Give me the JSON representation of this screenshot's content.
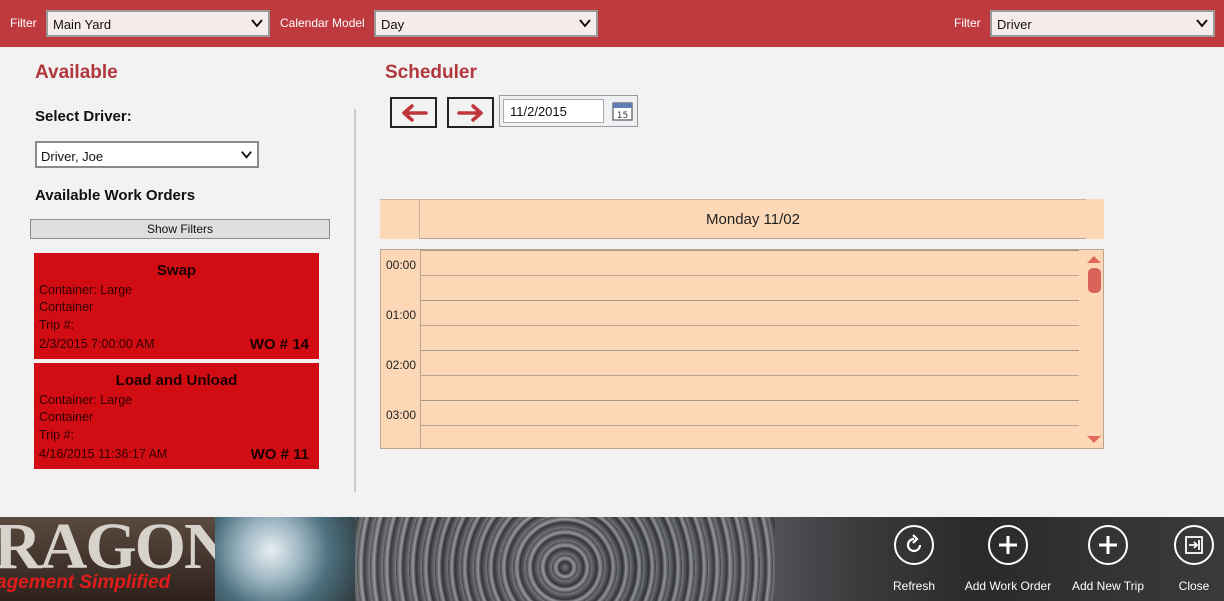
{
  "topbar": {
    "filter1_label": "Filter",
    "filter1_value": "Main Yard",
    "calendar_model_label": "Calendar Model",
    "calendar_model_value": "Day",
    "filter2_label": "Filter",
    "filter2_value": "Driver"
  },
  "available": {
    "title": "Available",
    "select_driver_label": "Select Driver:",
    "driver_value": "Driver, Joe",
    "work_orders_label": "Available Work Orders",
    "show_filters_label": "Show Filters",
    "work_orders": [
      {
        "title": "Swap",
        "container_line1": "Container: Large",
        "container_line2": "Container",
        "trip": "Trip #:",
        "datetime": "2/3/2015 7:00:00 AM",
        "wo_number": "WO # 14"
      },
      {
        "title": "Load and Unload",
        "container_line1": "Container: Large",
        "container_line2": "Container",
        "trip": "Trip #:",
        "datetime": "4/16/2015 11:36:17 AM",
        "wo_number": "WO # 11"
      }
    ]
  },
  "scheduler": {
    "title": "Scheduler",
    "date_value": "11/2/2015",
    "calendar_icon_day": "15",
    "day_header": "Monday 11/02",
    "times": [
      "00:00",
      "01:00",
      "02:00",
      "03:00"
    ]
  },
  "bottombar": {
    "logo_text": "RAGON",
    "logo_subtext": "agement Simplified",
    "buttons": {
      "refresh": "Refresh",
      "add_work_order": "Add Work Order",
      "add_new_trip": "Add New Trip",
      "close": "Close"
    }
  },
  "icons": {
    "prev": "arrow-left-icon",
    "next": "arrow-right-icon",
    "calendar": "calendar-icon",
    "refresh": "refresh-icon",
    "add": "plus-icon",
    "close": "exit-icon"
  },
  "colors": {
    "topbar": "#bf3a3f",
    "accent": "#b0383d",
    "work_order": "#d10c12",
    "calendar_bg": "#fdd8b6"
  }
}
